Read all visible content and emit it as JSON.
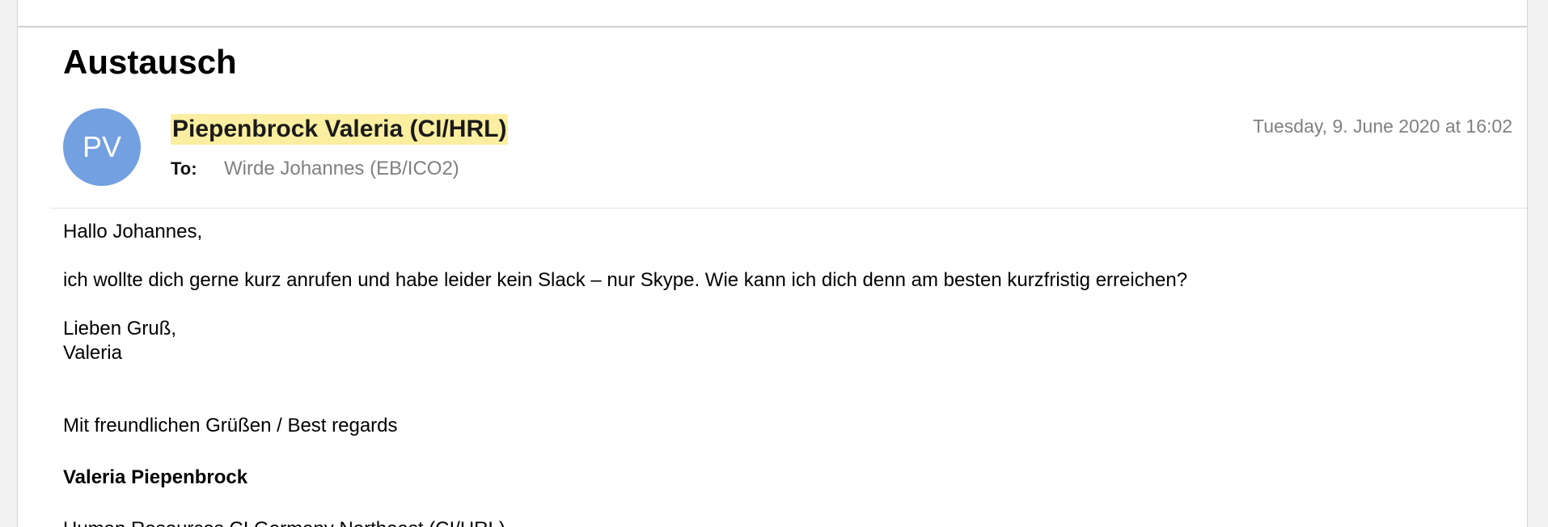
{
  "message": {
    "subject": "Austausch",
    "sender": {
      "initials": "PV",
      "name": "Piepenbrock Valeria (CI/HRL)"
    },
    "to_label": "To:",
    "to_value": "Wirde Johannes (EB/ICO2)",
    "date": "Tuesday, 9. June 2020 at 16:02",
    "body": {
      "greeting": "Hallo Johannes,",
      "paragraph": "ich wollte dich gerne kurz anrufen und habe leider kein Slack – nur Skype. Wie kann ich dich denn am besten kurzfristig erreichen?",
      "closing_line1": "Lieben Gruß,",
      "closing_line2": "Valeria",
      "signature_regards": "Mit freundlichen Grüßen / Best regards",
      "signature_name": "Valeria Piepenbrock",
      "signature_department": "Human Resources CI Germany Northeast (CI/HRL)"
    }
  },
  "colors": {
    "avatar_bg": "#72a0e0",
    "sender_highlight": "#fbeea0",
    "muted_text": "#808080"
  }
}
